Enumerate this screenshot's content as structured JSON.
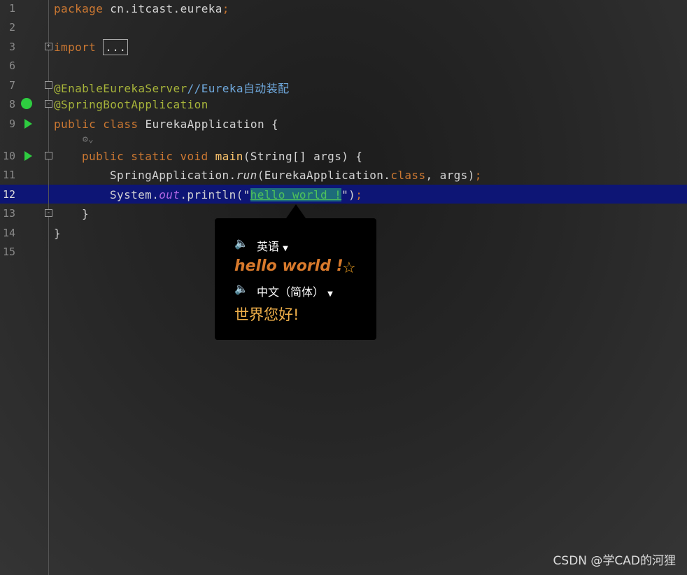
{
  "editor": {
    "line_numbers": [
      "1",
      "2",
      "3",
      "6",
      "7",
      "8",
      "9",
      "10",
      "11",
      "12",
      "13",
      "14",
      "15"
    ],
    "line1": {
      "kw": "package",
      "rest": " cn.itcast.eureka",
      "semi": ";"
    },
    "line3": {
      "kw": "import",
      "folded": "..."
    },
    "line7": {
      "ann": "@EnableEurekaServer",
      "comment": "//Eureka自动装配"
    },
    "line8": {
      "ann": "@SpringBootApplication"
    },
    "line9": {
      "kw": "public class",
      "rest": " EurekaApplication {"
    },
    "line10": {
      "kw": "public static void",
      "fn": " main",
      "rest": "(String[] args) {"
    },
    "line11": {
      "a": "SpringApplication.",
      "run": "run",
      "b": "(EurekaApplication.",
      "cls": "class",
      "c": ", args)",
      "semi": ";"
    },
    "line12": {
      "a": "System.",
      "out": "out",
      "b": ".println(\"",
      "str": "hello world !",
      "c": "\")",
      "semi": ";"
    },
    "line13": "}",
    "line14": "}"
  },
  "popup": {
    "source_lang": "英语",
    "source_text": "hello world !",
    "target_lang": "中文（简体）",
    "target_text": "世界您好!",
    "speaker_icon": "speaker-icon",
    "star_icon": "star-icon",
    "accent": "#d97a2c"
  },
  "watermark": "CSDN @学CAD的河狸"
}
